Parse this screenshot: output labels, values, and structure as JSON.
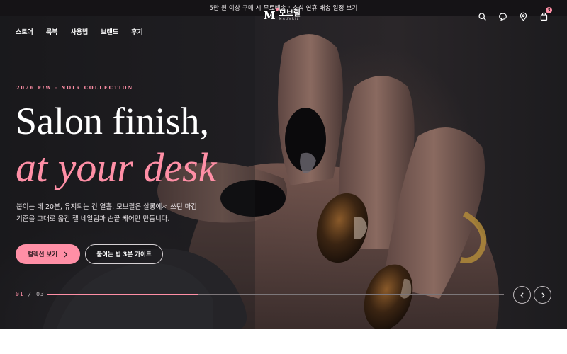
{
  "announcement": {
    "text": "5만 원 이상 구매 시 무료배송",
    "separator": "·",
    "link": "추석 연휴 배송 일정 보기"
  },
  "nav": {
    "menu": [
      "스토어",
      "룩북",
      "사용법",
      "브랜드",
      "후기"
    ],
    "logo_mark": "M",
    "logo_name": "모브릴",
    "logo_sub": "MAUVRIL",
    "icons": [
      "search-icon",
      "chat-icon",
      "location-icon",
      "bag-icon"
    ],
    "cart_count": "3"
  },
  "hero": {
    "eyebrow": "2026 F/W · NOIR COLLECTION",
    "headline_line1": "Salon finish,",
    "headline_line2": "at your desk",
    "description_line1": "붙이는 데 20분, 유지되는 건 열흘. 모브릴은 살롱에서 쓰던 마감",
    "description_line2": "기준을 그대로 옮긴 젤 네일팁과 손끝 케어만 만듭니다.",
    "primary_button": "컬렉션 보기",
    "secondary_button": "붙이는 법 3분 가이드",
    "slide_current": "01",
    "slide_separator": "/",
    "slide_total": "03",
    "slide_progress": 0.33
  },
  "colors": {
    "accent": "#ff8fa6",
    "dark": "#151316"
  }
}
